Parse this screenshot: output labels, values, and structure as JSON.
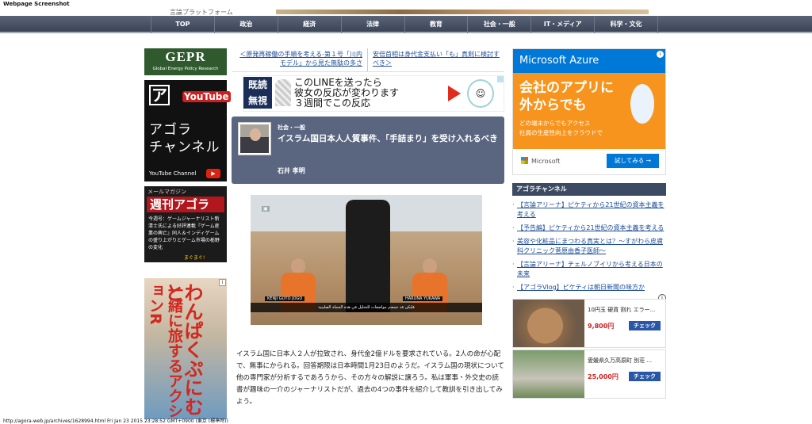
{
  "screenshot_label": "Webpage Screenshot",
  "header": {
    "tagline": "言論プラットフォーム"
  },
  "nav": [
    "TOP",
    "政治",
    "経済",
    "法律",
    "教育",
    "社会・一般",
    "IT・メディア",
    "科学・文化"
  ],
  "left": {
    "gepr": {
      "title": "GEPR",
      "subtitle": "Global Energy Policy Research"
    },
    "agora_channel": {
      "logo": "ア",
      "youtube": "YouTube",
      "title": "アゴラ\nチャンネル",
      "footer": "YouTube Channel"
    },
    "mailmag": {
      "label": "メールマガジン",
      "name": "週刊アゴラ",
      "body": "今週号：ゲームジャーナリスト新清士氏による好評連載『ゲーム産業の興亡』同人＆インディゲームの盛り上がりとゲーム市場の栃野の変化",
      "brand": "まぐまぐ!"
    },
    "manga_ad": {
      "line1": "わんぱくぷにむと",
      "line2": "一緒に旅するアクションR"
    }
  },
  "main": {
    "prev_link": "＜原発再稼働の手順を考える-第１号「川内モデル」から見た無駄の多さ",
    "next_link": "安倍首相は身代金支払い「も」真剣に検討すべき＞",
    "line_ad": {
      "badge": "既読\n無視",
      "text": "このLINEを送ったら\n彼女の反応が変わります\n３週間でこの反応"
    },
    "article": {
      "category": "社会・一般",
      "title": "イスラム国日本人人質事件、「手詰まり」を受け入れるべき",
      "author": "石井 孝明"
    },
    "image": {
      "name_left": "KENJI GOTO JOGO",
      "name_right": "HARUNA YUKAWA",
      "caption": "فليكن قد جمعتم مواصفات للتحليل في هذه الجملة الصليبية"
    },
    "body": "イスラム国に日本人２人が拉致され、身代金2億ドルを要求されている。2人の命が心配で、無事にかられる。回答期限は日本時間1月23日のようだ。イスラム国の現状について他の専門家が分析するであろうから、その方々の解説に譲ろう。私は軍事・外交史の読書が趣味の一介のジャーナリストだが、過去の4つの事件を紹介して教訓を引き出してみよう。"
  },
  "right": {
    "azure": {
      "brand": "Microsoft Azure",
      "headline": "会社のアプリに\n外からでも",
      "sub": "どの端末からでもアクセス\n社員の生産性向上をクラウドで",
      "ms": "Microsoft",
      "cta": "試してみる →"
    },
    "agora_channel_title": "アゴラチャンネル",
    "links": [
      "【言論アリーナ】ピケティから21世紀の資本主義を考える",
      "【予告編】ピケティから21世紀の資本主義を考える",
      "美容や化粧品にまつわる真実とは？～すがわら皮膚科クリニック菅原由香子医師～",
      "【言論アリーナ】チェルノブイリから考える日本の未来",
      "【アゴラVlog】ピケティは朝日新聞の味方か"
    ],
    "shop": [
      {
        "name": "10円玉 硬貨 割れ エラー...",
        "price": "9,800円",
        "button": "チェック"
      },
      {
        "name": "愛媛県久万高原町 別荘 ...",
        "price": "25,000円",
        "button": "チェック"
      }
    ]
  },
  "statusbar": "http://agora-web.jp/archives/1628994.html Fri Jan 23 2015 23:28:52 GMT+0900 (東京 (標準時))"
}
